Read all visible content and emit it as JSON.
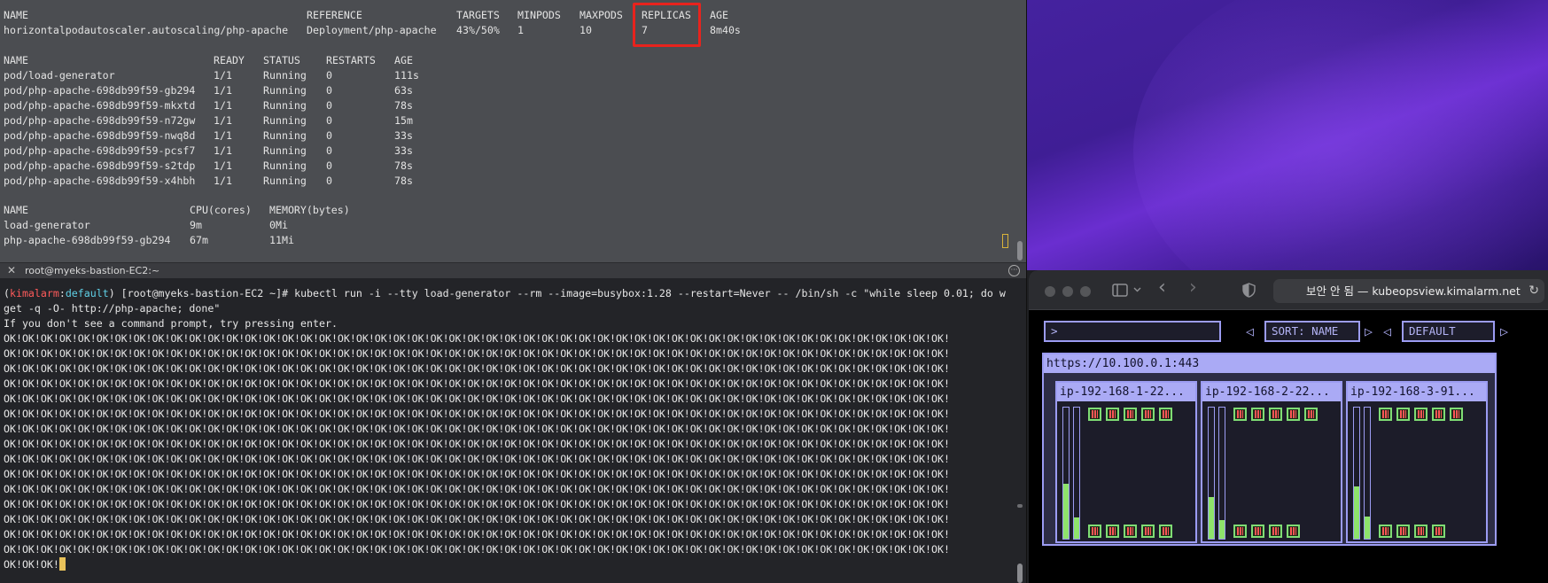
{
  "terminal_top": {
    "hpa": {
      "headers": [
        "NAME",
        "REFERENCE",
        "TARGETS",
        "MINPODS",
        "MAXPODS",
        "REPLICAS",
        "AGE"
      ],
      "row": [
        "horizontalpodautoscaler.autoscaling/php-apache",
        "Deployment/php-apache",
        "43%/50%",
        "1",
        "10",
        "7",
        "8m40s"
      ]
    },
    "pods": {
      "headers": [
        "NAME",
        "READY",
        "STATUS",
        "RESTARTS",
        "AGE"
      ],
      "rows": [
        [
          "pod/load-generator",
          "1/1",
          "Running",
          "0",
          "111s"
        ],
        [
          "pod/php-apache-698db99f59-gb294",
          "1/1",
          "Running",
          "0",
          "63s"
        ],
        [
          "pod/php-apache-698db99f59-mkxtd",
          "1/1",
          "Running",
          "0",
          "78s"
        ],
        [
          "pod/php-apache-698db99f59-n72gw",
          "1/1",
          "Running",
          "0",
          "15m"
        ],
        [
          "pod/php-apache-698db99f59-nwq8d",
          "1/1",
          "Running",
          "0",
          "33s"
        ],
        [
          "pod/php-apache-698db99f59-pcsf7",
          "1/1",
          "Running",
          "0",
          "33s"
        ],
        [
          "pod/php-apache-698db99f59-s2tdp",
          "1/1",
          "Running",
          "0",
          "78s"
        ],
        [
          "pod/php-apache-698db99f59-x4hbh",
          "1/1",
          "Running",
          "0",
          "78s"
        ]
      ]
    },
    "top": {
      "headers": [
        "NAME",
        "CPU(cores)",
        "MEMORY(bytes)"
      ],
      "rows": [
        [
          "load-generator",
          "9m",
          "0Mi"
        ],
        [
          "php-apache-698db99f59-gb294",
          "67m",
          "11Mi"
        ]
      ]
    }
  },
  "tab_bar": {
    "close_glyph": "✕",
    "title": "root@myeks-bastion-EC2:~",
    "more_glyph": "···"
  },
  "terminal_bottom": {
    "prompt_open": "(",
    "ctx_cluster": "kimalarm",
    "ctx_sep": ":",
    "ctx_namespace": "default",
    "prompt_rest": ") [root@myeks-bastion-EC2 ~]# ",
    "command_line1": "kubectl run -i --tty load-generator --rm --image=busybox:1.28 --restart=Never -- /bin/sh -c \"while sleep 0.01; do w",
    "command_line2": "get -q -O- http://php-apache; done\"",
    "hint": "If you don't see a command prompt, try pressing enter.",
    "ok_line": "OK!OK!OK!OK!OK!OK!OK!OK!OK!OK!OK!OK!OK!OK!OK!OK!OK!OK!OK!OK!OK!OK!OK!OK!OK!OK!OK!OK!OK!OK!OK!OK!OK!OK!OK!OK!OK!OK!OK!OK!OK!OK!OK!OK!OK!OK!OK!OK!OK!OK!OK!",
    "ok_last": "OK!OK!OK!"
  },
  "browser": {
    "url_label": "보안 안 됨 — kubeopsview.kimalarm.net",
    "reload_glyph": "↻",
    "back_glyph": "‹",
    "forward_glyph": "›"
  },
  "kube_ops_view": {
    "filter_prompt": ">",
    "sort_label": "SORT: NAME",
    "theme_label": "DEFAULT",
    "arrow_left": "◁",
    "arrow_right": "▷",
    "cluster_name": "https://10.100.0.1:443",
    "nodes": [
      {
        "name": "ip-192-168-1-22...",
        "cpu": 0.42,
        "mem": 0.16,
        "top_pods": 5,
        "bottom_pods": 5
      },
      {
        "name": "ip-192-168-2-22...",
        "cpu": 0.32,
        "mem": 0.14,
        "top_pods": 5,
        "bottom_pods": 4
      },
      {
        "name": "ip-192-168-3-91...",
        "cpu": 0.4,
        "mem": 0.17,
        "top_pods": 5,
        "bottom_pods": 4
      }
    ],
    "colors": {
      "frame": "#9c9cf2",
      "pod_border": "#7fdc74",
      "pod_bars": "#ff5555",
      "usage": "#8ee36a"
    }
  }
}
